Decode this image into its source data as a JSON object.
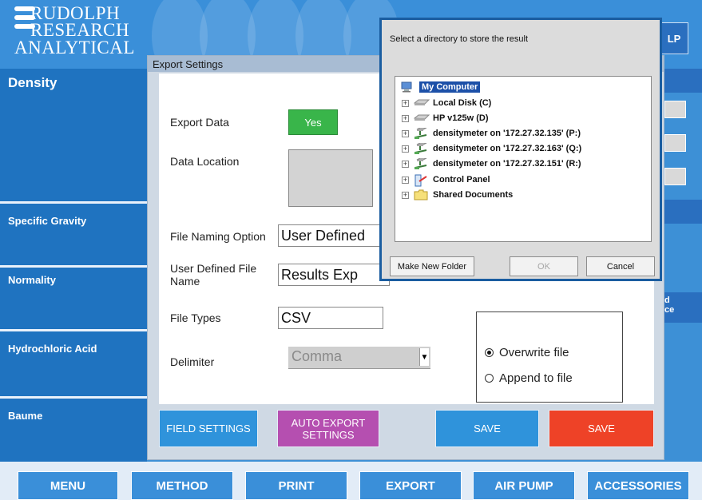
{
  "brand": {
    "line1": "RUDOLPH",
    "line2": "RESEARCH",
    "line3": "ANALYTICAL"
  },
  "header": {
    "help_label": "LP"
  },
  "sidebar": {
    "items": [
      {
        "label": "Density"
      },
      {
        "label": "Specific Gravity"
      },
      {
        "label": "Normality"
      },
      {
        "label": "Hydrochloric Acid"
      },
      {
        "label": "Baume"
      }
    ]
  },
  "edge": {
    "text_line1": "d",
    "text_line2": "ce"
  },
  "export_settings": {
    "title": "Export Settings",
    "export_data_label": "Export Data",
    "export_data_value": "Yes",
    "data_location_label": "Data Location",
    "file_naming_label": "File Naming Option",
    "file_naming_value": "User Defined",
    "user_defined_label": "User Defined File Name",
    "user_defined_value": "Results Exp",
    "file_types_label": "File Types",
    "file_types_value": "CSV",
    "delimiter_label": "Delimiter",
    "delimiter_value": "Comma",
    "overwrite_label": "Overwrite file",
    "append_label": "Append to file",
    "write_mode_selected": "overwrite",
    "buttons": {
      "field_settings": "FIELD SETTINGS",
      "auto_export_line1": "AUTO EXPORT",
      "auto_export_line2": "SETTINGS",
      "save_blue": "SAVE",
      "save_red": "SAVE"
    }
  },
  "directory_dialog": {
    "prompt": "Select a directory to store the result",
    "tree": [
      {
        "label": "My Computer",
        "icon": "computer-icon",
        "selected": true
      },
      {
        "label": "Local Disk (C)",
        "icon": "drive-icon"
      },
      {
        "label": "HP v125w (D)",
        "icon": "drive-icon"
      },
      {
        "label": "densitymeter on '172.27.32.135' (P:)",
        "icon": "network-drive-icon"
      },
      {
        "label": "densitymeter on '172.27.32.163' (Q:)",
        "icon": "network-drive-icon"
      },
      {
        "label": "densitymeter on '172.27.32.151' (R:)",
        "icon": "network-drive-icon"
      },
      {
        "label": "Control Panel",
        "icon": "control-panel-icon"
      },
      {
        "label": "Shared Documents",
        "icon": "folder-icon"
      }
    ],
    "make_new_folder": "Make New Folder",
    "ok": "OK",
    "cancel": "Cancel"
  },
  "bottom_nav": {
    "menu": "MENU",
    "method": "METHOD",
    "print": "PRINT",
    "export": "EXPORT",
    "air_pump": "AIR PUMP",
    "accessories": "ACCESSORIES"
  },
  "colors": {
    "app_blue": "#3d90d6",
    "sidebar_blue": "#1f73c0",
    "yes_green": "#39b54a",
    "auto_export_purple": "#b54fb0",
    "save_blue": "#2f93db",
    "save_red": "#ee4227"
  }
}
